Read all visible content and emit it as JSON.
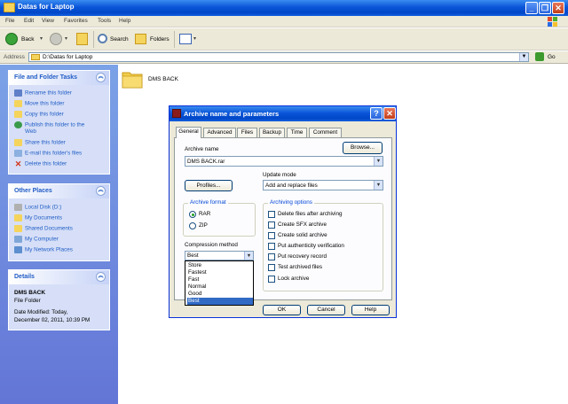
{
  "window": {
    "title": "Datas for Laptop",
    "caption_buttons": [
      "_",
      "❐",
      "✕"
    ]
  },
  "menu": [
    "File",
    "Edit",
    "View",
    "Favorites",
    "Tools",
    "Help"
  ],
  "toolbar": {
    "back": "Back",
    "search": "Search",
    "folders": "Folders"
  },
  "address": {
    "label": "Address",
    "value": "D:\\Datas for Laptop",
    "go": "Go"
  },
  "tasks": {
    "title": "File and Folder Tasks",
    "items": [
      {
        "label": "Rename this folder",
        "icon": "rename-icon"
      },
      {
        "label": "Move this folder",
        "icon": "move-icon"
      },
      {
        "label": "Copy this folder",
        "icon": "copy-icon"
      },
      {
        "label": "Publish this folder to the",
        "label2": "Web",
        "icon": "publish-web-icon"
      },
      {
        "label": "Share this folder",
        "icon": "share-icon"
      },
      {
        "label": "E-mail this folder's files",
        "icon": "email-icon"
      },
      {
        "label": "Delete this folder",
        "icon": "delete-icon"
      }
    ]
  },
  "other_places": {
    "title": "Other Places",
    "items": [
      {
        "label": "Local Disk (D:)",
        "icon": "local-disk-icon"
      },
      {
        "label": "My Documents",
        "icon": "my-documents-icon"
      },
      {
        "label": "Shared Documents",
        "icon": "shared-documents-icon"
      },
      {
        "label": "My Computer",
        "icon": "my-computer-icon"
      },
      {
        "label": "My Network Places",
        "icon": "network-places-icon"
      }
    ]
  },
  "details": {
    "title": "Details",
    "name": "DMS BACK",
    "type": "File Folder",
    "modified_line1": "Date Modified: Today,",
    "modified_line2": "December 02, 2011, 10:39 PM"
  },
  "folder_item": {
    "label": "DMS BACK"
  },
  "dialog": {
    "title": "Archive name and parameters",
    "help_btn": "?",
    "close_btn": "✕",
    "tabs": [
      "General",
      "Advanced",
      "Files",
      "Backup",
      "Time",
      "Comment"
    ],
    "archive_name_label": "Archive name",
    "browse": "Browse...",
    "archive_name_value": "DMS BACK.rar",
    "profiles": "Profiles...",
    "update_mode_label": "Update mode",
    "update_mode_value": "Add and replace files",
    "archive_format_label": "Archive format",
    "format_rar": "RAR",
    "format_zip": "ZIP",
    "archive_format_selected": "RAR",
    "compression_label": "Compression method",
    "compression_value": "Best",
    "compression_options": [
      "Store",
      "Fastest",
      "Fast",
      "Normal",
      "Good",
      "Best"
    ],
    "compression_selected": "Best",
    "options_label": "Archiving options",
    "options": [
      {
        "label": "Delete files after archiving",
        "checked": false
      },
      {
        "label": "Create SFX archive",
        "checked": false
      },
      {
        "label": "Create solid archive",
        "checked": false
      },
      {
        "label": "Put authenticity verification",
        "checked": false
      },
      {
        "label": "Put recovery record",
        "checked": false
      },
      {
        "label": "Test archived files",
        "checked": false
      },
      {
        "label": "Lock archive",
        "checked": false
      }
    ],
    "ok": "OK",
    "cancel": "Cancel",
    "help": "Help"
  }
}
